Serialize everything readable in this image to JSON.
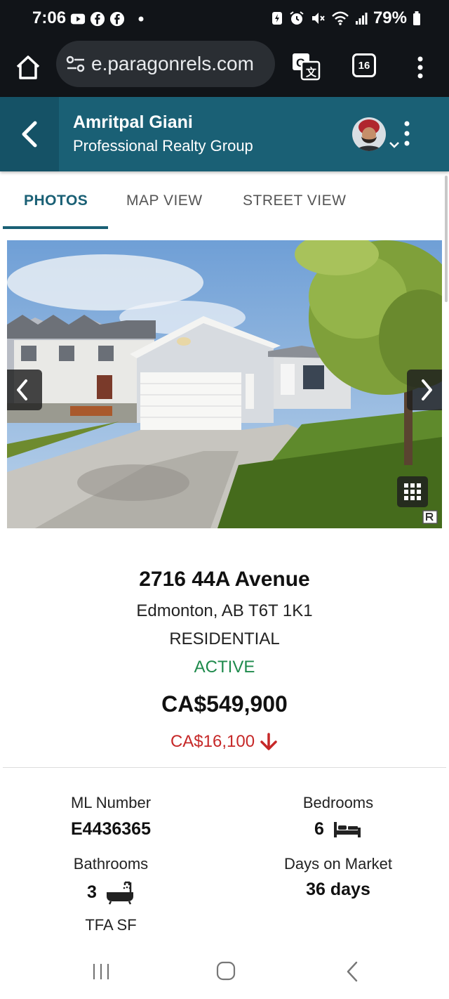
{
  "status_bar": {
    "time": "7:06",
    "battery": "79%"
  },
  "browser": {
    "url": "e.paragonrels.com",
    "tab_count": "16"
  },
  "header": {
    "agent_name": "Amritpal Giani",
    "company": "Professional Realty Group"
  },
  "tabs": [
    {
      "label": "PHOTOS",
      "active": true
    },
    {
      "label": "MAP VIEW",
      "active": false
    },
    {
      "label": "STREET VIEW",
      "active": false
    }
  ],
  "listing": {
    "address_line1": "2716 44A Avenue",
    "address_line2": "Edmonton, AB T6T 1K1",
    "property_type": "RESIDENTIAL",
    "status": "ACTIVE",
    "price": "CA$549,900",
    "price_change": "CA$16,100",
    "price_change_direction": "down"
  },
  "stats": {
    "ml_number_label": "ML Number",
    "ml_number": "E4436365",
    "bedrooms_label": "Bedrooms",
    "bedrooms": "6",
    "bathrooms_label": "Bathrooms",
    "bathrooms": "3",
    "days_label": "Days on Market",
    "days": "36 days",
    "tfa_label": "TFA SF"
  },
  "colors": {
    "header_bg": "#1a6075",
    "active_status": "#1e8a4c",
    "price_drop": "#c62828"
  },
  "icons": [
    "youtube-icon",
    "facebook-icon",
    "home-icon",
    "tune-icon",
    "translate-icon",
    "kebab-menu-icon",
    "bed-icon",
    "bathtub-icon",
    "grid-icon",
    "chevron-left-icon",
    "chevron-right-icon",
    "arrow-down-icon"
  ]
}
